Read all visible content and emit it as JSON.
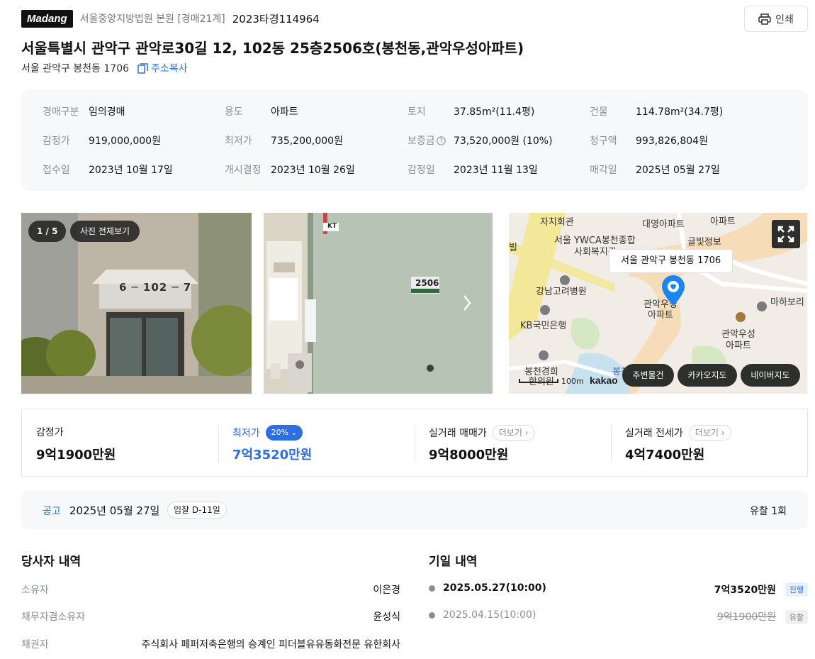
{
  "header": {
    "logo": "Madang",
    "court": "서울중앙지방법원 본원 [경매21계]",
    "case_number": "2023타경114964",
    "print_label": "인쇄"
  },
  "address": {
    "title": "서울특별시 관악구 관악로30길 12, 102동 25층2506호(봉천동,관악우성아파트)",
    "lot": "서울 관악구 봉천동 1706",
    "copy_label": "주소복사"
  },
  "info": {
    "auction_type_label": "경매구분",
    "auction_type": "임의경매",
    "use_label": "용도",
    "use": "아파트",
    "land_label": "토지",
    "land": "37.85m²(11.4평)",
    "building_label": "건물",
    "building": "114.78m²(34.7평)",
    "appraisal_label": "감정가",
    "appraisal": "919,000,000원",
    "minimum_label": "최저가",
    "minimum": "735,200,000원",
    "deposit_label": "보증금",
    "deposit": "73,520,000원 (10%)",
    "claim_label": "청구액",
    "claim": "993,826,804원",
    "received_label": "접수일",
    "received": "2023년 10월 17일",
    "commence_label": "개시결정",
    "commence": "2023년 10월 26일",
    "appraised_label": "감정일",
    "appraised": "2023년 11월 13일",
    "sale_label": "매각일",
    "sale": "2025년 05월 27일"
  },
  "gallery": {
    "counter": "1 / 5",
    "view_all": "사진 전체보기",
    "sign_text": "6 ─ 102 ─ 7",
    "door_number": "2506",
    "sticker_text": "KT"
  },
  "map": {
    "address_label": "서울 관악구 봉천동 1706",
    "places": [
      "자치회관",
      "대영아파트",
      "아파트",
      "서울 YWCA봉천종합",
      "사회복지관",
      "글빛정보",
      "빌",
      "강남고려병원",
      "관악우성",
      "아파트",
      "마하보리",
      "KB국민은행",
      "관악우성",
      "아파트",
      "봉천경희",
      "한의원",
      "봉천"
    ],
    "scale": "100m",
    "brand": "kakao",
    "buttons": [
      "주변물건",
      "카카오지도",
      "네이버지도"
    ]
  },
  "prices": {
    "appraisal_label": "감정가",
    "appraisal": "9억1900만원",
    "minimum_label": "최저가",
    "minimum_badge": "20%",
    "minimum": "7억3520만원",
    "trade_label": "실거래 매매가",
    "trade_more": "더보기",
    "trade": "9억8000만원",
    "jeonse_label": "실거래 전세가",
    "jeonse_more": "더보기",
    "jeonse": "4억7400만원"
  },
  "notice": {
    "label": "공고",
    "date": "2025년 05월 27일",
    "dday": "입찰 D-11일",
    "failed": "유찰 1회"
  },
  "parties": {
    "title": "당사자 내역",
    "rows": [
      {
        "role": "소유자",
        "name": "이은경"
      },
      {
        "role": "채무자겸소유자",
        "name": "윤성식"
      },
      {
        "role": "채권자",
        "name": "주식회사 페퍼저축은행의 승계인 피더블유유동화전문 유한회사"
      }
    ]
  },
  "schedule": {
    "title": "기일 내역",
    "rows": [
      {
        "date": "2025.05.27(10:00)",
        "price": "7억3520만원",
        "status": "진행"
      },
      {
        "date": "2025.04.15(10:00)",
        "price": "9억1900만원",
        "status": "유찰"
      }
    ]
  },
  "colors": {
    "accent": "#2e6fe0",
    "panel": "#f6f8fa",
    "marker": "#1a86f0"
  }
}
